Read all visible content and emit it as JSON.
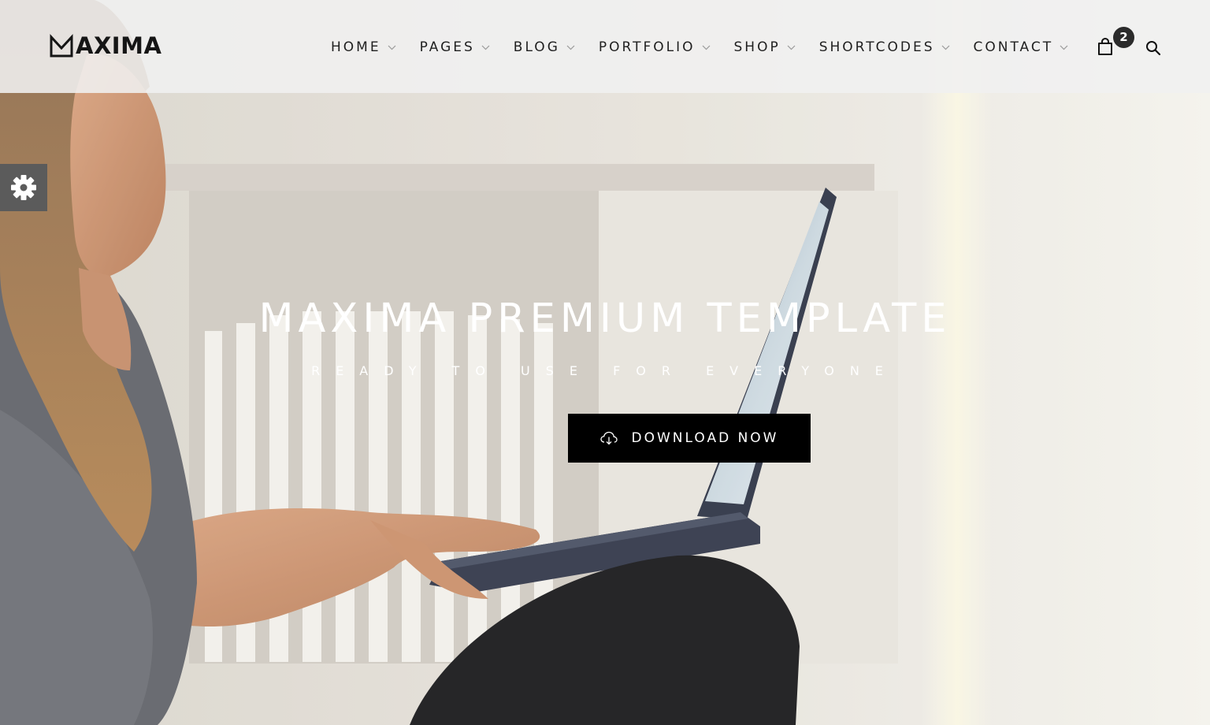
{
  "brand": {
    "logo_text": "AXIMA"
  },
  "nav": {
    "items": [
      {
        "label": "HOME"
      },
      {
        "label": "PAGES"
      },
      {
        "label": "BLOG"
      },
      {
        "label": "PORTFOLIO"
      },
      {
        "label": "SHOP"
      },
      {
        "label": "SHORTCODES"
      },
      {
        "label": "CONTACT"
      }
    ],
    "cart_count": "2",
    "icons": {
      "cart": "shopping-bag-icon",
      "search": "search-icon",
      "dropdown": "chevron-down-icon"
    }
  },
  "settings": {
    "icon": "gear-icon"
  },
  "hero": {
    "title": "MAXIMA PREMIUM TEMPLATE",
    "subtitle": "READY TO USE FOR EVERYONE",
    "cta_label": "DOWNLOAD NOW",
    "cta_icon": "cloud-download-icon"
  },
  "colors": {
    "header_bg": "#f0f0f0",
    "text_dark": "#1f1f1f",
    "button_bg": "#000000",
    "badge_bg": "#2b2b2b",
    "settings_tab_bg": "#5b5b5b",
    "hero_text": "#ffffff"
  }
}
